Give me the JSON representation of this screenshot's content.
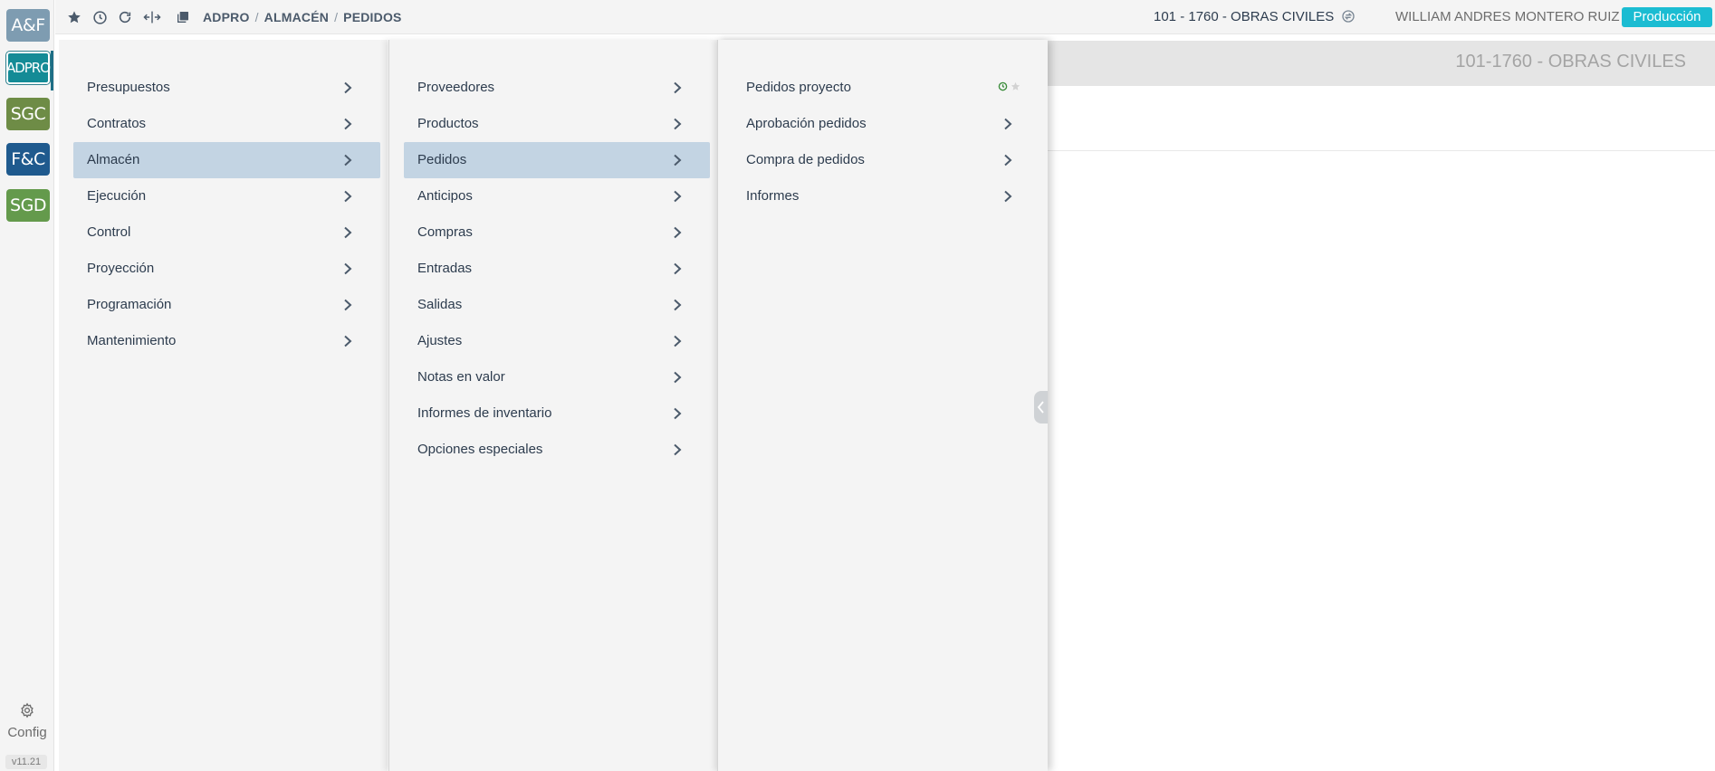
{
  "apps": [
    {
      "label": "A&F",
      "color": "#7e9cb1"
    },
    {
      "label": "ADPRO",
      "color": "#148b96",
      "active": true
    },
    {
      "label": "SGC",
      "color": "#6e8c46"
    },
    {
      "label": "F&C",
      "color": "#1f5a8e"
    },
    {
      "label": "SGD",
      "color": "#649a4c"
    }
  ],
  "rail": {
    "config_label": "Config",
    "version": "v11.21"
  },
  "topbar": {
    "icons": [
      "star-icon",
      "history-icon",
      "refresh-icon",
      "split-view-icon",
      "copy-windows-icon"
    ],
    "breadcrumb": [
      "ADPRO",
      "ALMACÉN",
      "PEDIDOS"
    ],
    "project": "101 - 1760 - OBRAS CIVILES",
    "user": "WILLIAM ANDRES MONTERO RUIZ",
    "environment": "Producción"
  },
  "content": {
    "header_title": "101-1760 - OBRAS CIVILES"
  },
  "menu": {
    "level1": [
      "Presupuestos",
      "Contratos",
      "Almacén",
      "Ejecución",
      "Control",
      "Proyección",
      "Programación",
      "Mantenimiento"
    ],
    "level1_selected": "Almacén",
    "level2": [
      "Proveedores",
      "Productos",
      "Pedidos",
      "Anticipos",
      "Compras",
      "Entradas",
      "Salidas",
      "Ajustes",
      "Notas en valor",
      "Informes de inventario",
      "Opciones especiales"
    ],
    "level2_selected": "Pedidos",
    "level3": [
      {
        "label": "Pedidos proyecto",
        "leaf": true
      },
      {
        "label": "Aprobación pedidos",
        "leaf": false
      },
      {
        "label": "Compra de pedidos",
        "leaf": false
      },
      {
        "label": "Informes",
        "leaf": false
      }
    ]
  },
  "colors": {
    "accent": "#1bbcd2",
    "selected_row": "#c3d4e3",
    "menu_bg": "#f4f4f4"
  }
}
